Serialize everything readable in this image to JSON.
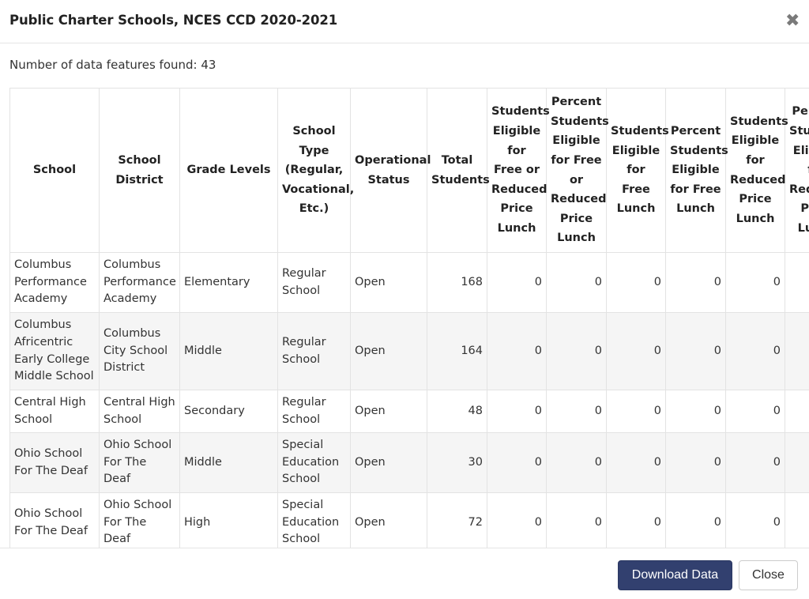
{
  "modal": {
    "title": "Public Charter Schools, NCES CCD 2020-2021",
    "close_icon": "close-x-icon",
    "count_text": "Number of data features found: 43"
  },
  "table": {
    "headers": [
      "School",
      "School District",
      "Grade Levels",
      "School Type (Regular, Vocational, Etc.)",
      "Operational Status",
      "Total Students",
      "Students Eligible for Free or Reduced Price Lunch",
      "Percent Students Eligible for Free or Reduced Price Lunch",
      "Students Eligible for Free Lunch",
      "Percent Students Eligible for Free Lunch",
      "Students Eligible for Reduced Price Lunch",
      "Percent Students Eligible for Reduced Price Lunch"
    ],
    "rows": [
      [
        "Columbus Performance Academy",
        "Columbus Performance Academy",
        "Elementary",
        "Regular School",
        "Open",
        "168",
        "0",
        "0",
        "0",
        "0",
        "0",
        ""
      ],
      [
        "Columbus Africentric Early College Middle School",
        "Columbus City School District",
        "Middle",
        "Regular School",
        "Open",
        "164",
        "0",
        "0",
        "0",
        "0",
        "0",
        ""
      ],
      [
        "Central High School",
        "Central High School",
        "Secondary",
        "Regular School",
        "Open",
        "48",
        "0",
        "0",
        "0",
        "0",
        "0",
        ""
      ],
      [
        "Ohio School For The Deaf",
        "Ohio School For The Deaf",
        "Middle",
        "Special Education School",
        "Open",
        "30",
        "0",
        "0",
        "0",
        "0",
        "0",
        ""
      ],
      [
        "Ohio School For The Deaf",
        "Ohio School For The Deaf",
        "High",
        "Special Education School",
        "Open",
        "72",
        "0",
        "0",
        "0",
        "0",
        "0",
        ""
      ]
    ]
  },
  "footer": {
    "download_label": "Download Data",
    "close_label": "Close"
  },
  "colors": {
    "primary_button": "#32406f",
    "row_alt": "#f5f5f5",
    "border": "#e3e3e3"
  }
}
